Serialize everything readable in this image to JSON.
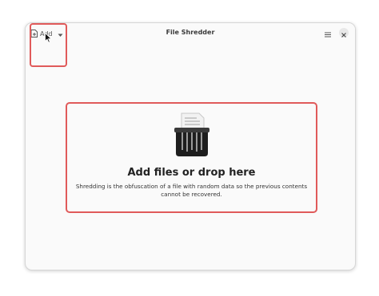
{
  "window": {
    "title": "File Shredder"
  },
  "toolbar": {
    "add_label": "Add",
    "add_icon": "document-add-icon",
    "dropdown_icon": "chevron-down-icon",
    "menu_icon": "hamburger-menu-icon",
    "close_icon": "close-icon"
  },
  "drop_zone": {
    "icon": "shredder-icon",
    "title": "Add files or drop here",
    "description": "Shredding is the obfuscation of a file with random data so the previous contents cannot be recovered."
  },
  "colors": {
    "highlight": "#e05a5a",
    "window_bg": "#fafafa",
    "shredder_body": "#1e1e1e"
  }
}
